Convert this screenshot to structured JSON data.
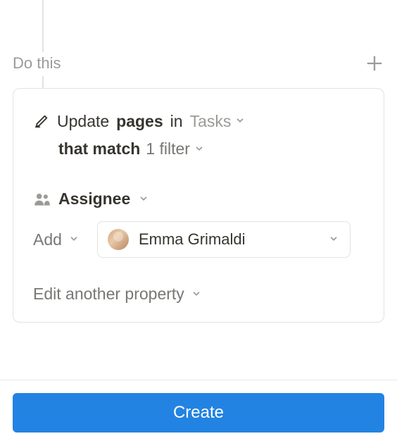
{
  "section": {
    "label": "Do this"
  },
  "action": {
    "verb": "Update",
    "object": "pages",
    "preposition": "in",
    "database": "Tasks",
    "match_prefix": "that match",
    "filter_count": "1 filter"
  },
  "property": {
    "name": "Assignee",
    "operation": "Add",
    "value": {
      "name": "Emma Grimaldi"
    }
  },
  "edit_another": "Edit another property",
  "footer": {
    "create": "Create"
  }
}
